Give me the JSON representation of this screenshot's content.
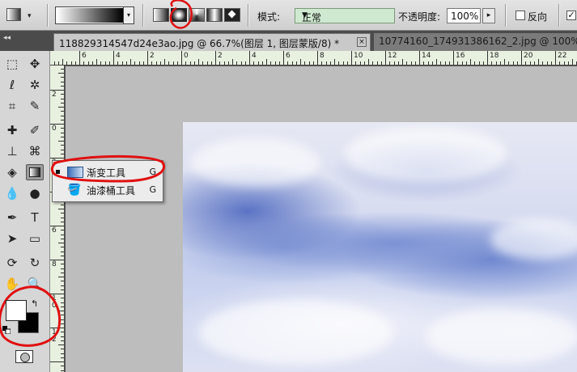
{
  "options_bar": {
    "tool_preset_icon": "gradient-tool-icon",
    "gradient_types": [
      "linear-gradient-icon",
      "radial-gradient-icon",
      "angle-gradient-icon",
      "reflected-gradient-icon",
      "diamond-gradient-icon"
    ],
    "selected_gradient_type": "radial",
    "mode_label": "模式:",
    "mode_value": "正常",
    "opacity_label": "不透明度:",
    "opacity_value": "100%",
    "reverse_label": "反向",
    "dither_mark": "✓",
    "mode_field_color": "#cfe9d0"
  },
  "tabs": [
    {
      "title": "118829314547d24e3ao.jpg @ 66.7%(图层 1, 图层蒙版/8) *",
      "close": "×"
    },
    {
      "title": "10774160_174931386162_2.jpg @ 100%"
    }
  ],
  "panel_collapse": "◂◂",
  "ruler": {
    "top_labels": [
      "6",
      "4",
      "2",
      "0",
      "2",
      "4",
      "6",
      "8",
      "10",
      "12",
      "14",
      "16",
      "18",
      "20",
      "22"
    ],
    "left_labels": [
      "2",
      "0",
      "2",
      "4",
      "6",
      "8",
      "1\n0",
      "1\n2"
    ]
  },
  "flyout": {
    "items": [
      {
        "label": "渐变工具",
        "shortcut": "G",
        "icon": "gradient-tool-icon"
      },
      {
        "label": "油漆桶工具",
        "shortcut": "G",
        "icon": "paint-bucket-icon"
      }
    ]
  },
  "colors": {
    "foreground": "#ffffff",
    "background": "#000000",
    "annotation": "#e01010",
    "canvas_bg": "#bdbdbd"
  }
}
